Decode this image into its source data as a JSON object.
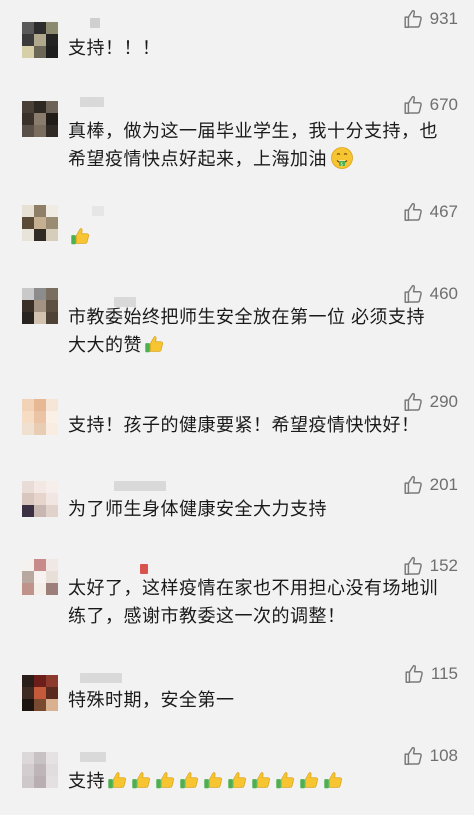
{
  "comments": [
    {
      "likes": "931",
      "text": "支持！！！",
      "emoji_count": 0,
      "avatar_colors": [
        "#5a5a5a",
        "#2d2d2d",
        "#8c8a6e",
        "#3b3b3b",
        "#b0a88c",
        "#232323",
        "#d6cfa8",
        "#6b6655",
        "#1e1e1e"
      ]
    },
    {
      "likes": "670",
      "text": "真棒，做为这一届毕业学生，我十分支持，也希望疫情快点好起来，上海加油",
      "emoji": "money-mouth-face",
      "avatar_colors": [
        "#4a4038",
        "#2e2822",
        "#6d6258",
        "#3a312a",
        "#8a7c6d",
        "#211c18",
        "#5b5047",
        "#7a6d60",
        "#302924"
      ]
    },
    {
      "likes": "467",
      "text": "",
      "emoji_count": 1,
      "avatar_colors": [
        "#e7e1d5",
        "#8f7f66",
        "#f0ece4",
        "#5b4a36",
        "#c4b090",
        "#9a8b73",
        "#e9e4da",
        "#2f2a24",
        "#d7cdbb"
      ]
    },
    {
      "likes": "460",
      "text": "市教委始终把师生安全放在第一位 必须支持大大的赞",
      "emoji_count": 1,
      "avatar_colors": [
        "#c9c9c9",
        "#8c8c8c",
        "#7a6e60",
        "#3a3028",
        "#a39383",
        "#5d4f42",
        "#2a2420",
        "#d2c3b0",
        "#4f4338"
      ]
    },
    {
      "likes": "290",
      "text": "支持！孩子的健康要紧！希望疫情快快好！",
      "emoji_count": 0,
      "avatar_colors": [
        "#f2d3b8",
        "#e6b894",
        "#f5e6d8",
        "#f7dcc4",
        "#eac4a4",
        "#fbf0e6",
        "#f0e0d0",
        "#e8cdb4",
        "#f9ece0"
      ]
    },
    {
      "likes": "201",
      "text": "为了师生身体健康安全大力支持",
      "emoji_count": 0,
      "avatar_colors": [
        "#e9dcd6",
        "#f3e8e3",
        "#f6eeea",
        "#d9c6bf",
        "#e6d4cd",
        "#f1e6e1",
        "#3c3045",
        "#c8b6b0",
        "#e2d2cc"
      ]
    },
    {
      "likes": "152",
      "text": "太好了，这样疫情在家也不用担心没有场地训练了，感谢市教委这一次的调整！",
      "emoji_count": 0,
      "avatar_colors": [
        "#f4f1ee",
        "#c98a8a",
        "#efe8e4",
        "#b8a8a0",
        "#f7f2ef",
        "#e9dfd9",
        "#c0938a",
        "#f4eee9",
        "#9c7f7a"
      ]
    },
    {
      "likes": "115",
      "text": "特殊时期，安全第一",
      "emoji_count": 0,
      "avatar_colors": [
        "#2a1e1a",
        "#6b1e1a",
        "#8c3a2c",
        "#3e2a22",
        "#c45a3a",
        "#5a2a1e",
        "#1e1410",
        "#7a4a30",
        "#d9b090"
      ]
    },
    {
      "likes": "108",
      "text": "支持",
      "emoji_count": 10,
      "avatar_colors": [
        "#dcd7d8",
        "#c9c2c4",
        "#e6e1e2",
        "#d3cdd0",
        "#bdb5b8",
        "#e1dcdd",
        "#cfc8ca",
        "#b9afb3",
        "#e4dfe0"
      ]
    }
  ],
  "nick_placeholders": [
    {
      "color": "#d9d9d9"
    },
    {
      "color": "#d9d9d9"
    },
    {
      "color": "#d9d9d9"
    },
    {
      "color": "#d9d9d9"
    },
    {
      "color": "#d9d9d9"
    },
    {
      "color": "#d9d9d9"
    },
    {
      "color": "#d9d9d9"
    },
    {
      "color": "#d9d9d9"
    },
    {
      "color": "#d9d9d9"
    }
  ],
  "icons": {
    "like": "thumbs-up-outline-icon",
    "thumb_emoji": "thumbs-up-emoji-icon",
    "face_emoji": "money-mouth-face-icon"
  },
  "colors": {
    "background": "#f2f2f2",
    "text": "#1a1a1a",
    "likes": "#6f6f6f",
    "emoji_yellow": "#f7c531",
    "emoji_green": "#4caf50"
  }
}
